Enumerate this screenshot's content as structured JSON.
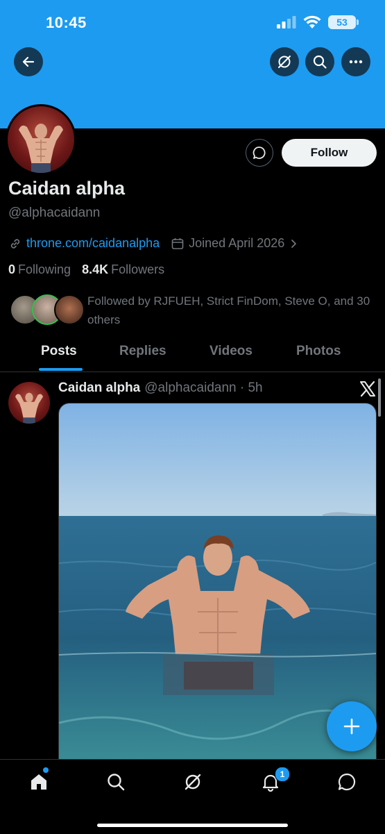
{
  "status_bar": {
    "time": "10:45",
    "battery": "53"
  },
  "profile": {
    "name": "Caidan alpha",
    "handle": "@alphacaidann",
    "link": "throne.com/caidanalpha",
    "joined": "Joined April 2026",
    "following_count": "0",
    "following_label": "Following",
    "followers_count": "8.4K",
    "followers_label": "Followers",
    "followed_by": "Followed by RJFUEH, Strict FinDom, Steve O, and 30 others",
    "follow_label": "Follow"
  },
  "tabs": [
    {
      "label": "Posts",
      "active": true
    },
    {
      "label": "Replies",
      "active": false
    },
    {
      "label": "Videos",
      "active": false
    },
    {
      "label": "Photos",
      "active": false
    }
  ],
  "post": {
    "author": "Caidan alpha",
    "handle_time": "@alphacaidann · 5h"
  },
  "bottom_nav": {
    "notification_count": "1"
  },
  "colors": {
    "accent": "#1d9bf0",
    "background": "#000000",
    "muted_text": "#71767b"
  },
  "icons": [
    "back-arrow-icon",
    "grok-icon",
    "search-icon",
    "more-icon",
    "message-icon",
    "link-icon",
    "calendar-icon",
    "chevron-right-icon",
    "x-logo-icon",
    "plus-icon",
    "home-icon",
    "bell-icon",
    "chat-icon"
  ]
}
